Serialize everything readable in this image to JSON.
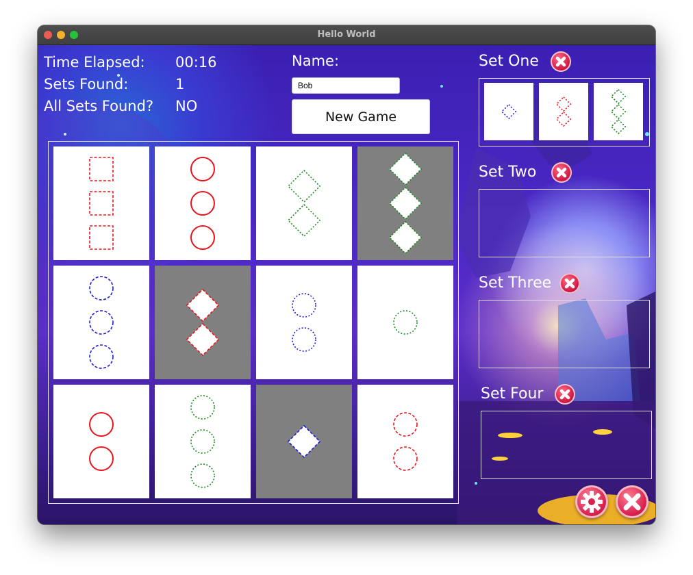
{
  "window": {
    "title": "Hello World"
  },
  "stats": {
    "time_label": "Time Elapsed:",
    "time_value": "00:16",
    "sets_label": "Sets Found:",
    "sets_value": "1",
    "all_label": "All Sets Found?",
    "all_value": "NO"
  },
  "player": {
    "name_label": "Name:",
    "name_value": "Bob"
  },
  "new_game_label": "New Game",
  "colors": {
    "red": "#e8141b",
    "green": "#13871a",
    "blue": "#1b1bd6",
    "selected_bg": "#808080"
  },
  "board": {
    "cards": [
      {
        "shape": "square",
        "count": 3,
        "color": "red",
        "fill": "dashed",
        "selected": false
      },
      {
        "shape": "circle",
        "count": 3,
        "color": "red",
        "fill": "solid",
        "selected": false
      },
      {
        "shape": "diamond",
        "count": 2,
        "color": "green",
        "fill": "dotted",
        "selected": false
      },
      {
        "shape": "diamond",
        "count": 3,
        "color": "green",
        "fill": "dotted",
        "selected": true
      },
      {
        "shape": "circle",
        "count": 3,
        "color": "blue",
        "fill": "dashed",
        "selected": false
      },
      {
        "shape": "diamond",
        "count": 2,
        "color": "red",
        "fill": "dashed",
        "selected": true
      },
      {
        "shape": "circle",
        "count": 2,
        "color": "blue",
        "fill": "dotted",
        "selected": false
      },
      {
        "shape": "circle",
        "count": 1,
        "color": "green",
        "fill": "dotted",
        "selected": false
      },
      {
        "shape": "circle",
        "count": 2,
        "color": "red",
        "fill": "solid",
        "selected": false
      },
      {
        "shape": "circle",
        "count": 3,
        "color": "green",
        "fill": "dotted",
        "selected": false
      },
      {
        "shape": "diamond",
        "count": 1,
        "color": "blue",
        "fill": "dashed",
        "selected": true
      },
      {
        "shape": "circle",
        "count": 2,
        "color": "red",
        "fill": "dashed",
        "selected": false
      }
    ]
  },
  "sets": [
    {
      "title": "Set One",
      "cards": [
        {
          "shape": "diamond",
          "count": 1,
          "color": "blue",
          "fill": "dotted"
        },
        {
          "shape": "diamond",
          "count": 2,
          "color": "red",
          "fill": "dotted"
        },
        {
          "shape": "diamond",
          "count": 3,
          "color": "green",
          "fill": "dotted"
        }
      ]
    },
    {
      "title": "Set Two",
      "cards": []
    },
    {
      "title": "Set Three",
      "cards": []
    },
    {
      "title": "Set Four",
      "cards": []
    }
  ],
  "icons": {
    "remove": "close-x-icon",
    "settings": "gear-icon",
    "quit": "close-x-icon"
  }
}
